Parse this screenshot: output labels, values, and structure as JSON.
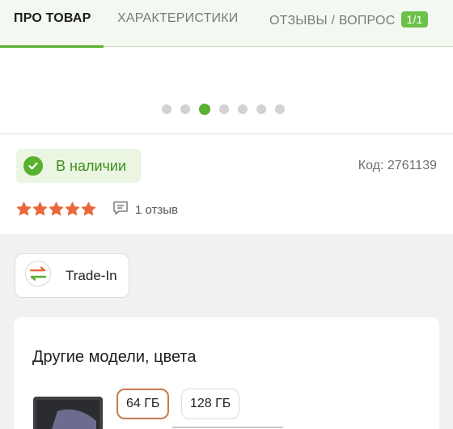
{
  "tabs": {
    "about": "ПРО ТОВАР",
    "characteristics": "ХАРАКТЕРИСТИКИ",
    "reviews": "ОТЗЫВЫ / ВОПРОС",
    "reviews_badge": "1/1"
  },
  "carousel": {
    "dot_count": 7,
    "active_index": 2
  },
  "availability": {
    "label": "В наличии",
    "icon": "check-circle-icon"
  },
  "product_code": "Код: 2761139",
  "rating": {
    "stars": 5,
    "max": 5,
    "reviews_text": "1 отзыв",
    "icon": "comment-icon"
  },
  "tradein": {
    "label": "Trade-In",
    "icon": "exchange-arrows-icon"
  },
  "models": {
    "title": "Другие модели, цвета",
    "options": [
      {
        "label": "64 ГБ",
        "selected": true
      },
      {
        "label": "128 ГБ",
        "selected": false
      }
    ]
  },
  "colors": {
    "accent": "#5ab02f",
    "star": "#e8683a",
    "selected_border": "#c87b4a"
  }
}
